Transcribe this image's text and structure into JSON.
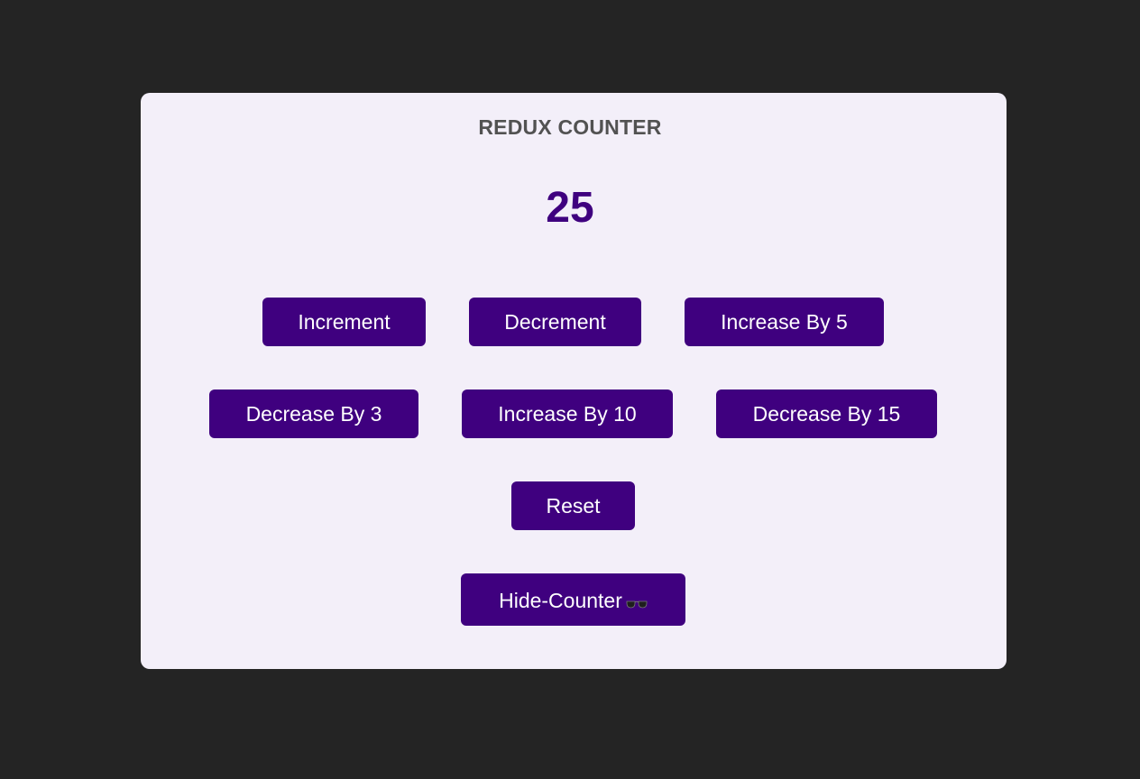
{
  "title": "REDUX COUNTER",
  "counter": {
    "value": "25"
  },
  "buttons": {
    "increment": "Increment",
    "decrement": "Decrement",
    "increase5": "Increase By 5",
    "decrease3": "Decrease By 3",
    "increase10": "Increase By 10",
    "decrease15": "Decrease By 15",
    "reset": "Reset",
    "hide_counter": "Hide-Counter"
  },
  "icons": {
    "hide_counter_icon": "sunglasses-icon"
  },
  "colors": {
    "background": "#242424",
    "card": "#f3eff9",
    "accent": "#3f007f",
    "title": "#525252",
    "button_text": "#ffffff"
  }
}
